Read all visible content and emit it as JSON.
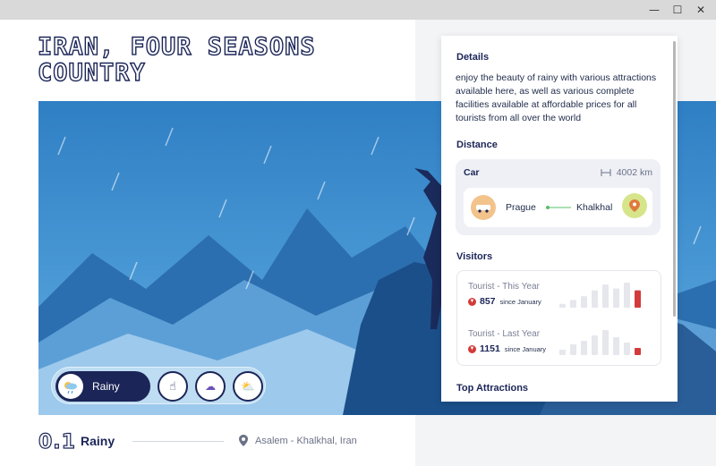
{
  "window": {
    "minimize_icon": "minimize-icon",
    "maximize_icon": "maximize-icon",
    "close_icon": "close-icon"
  },
  "hero": {
    "title": "Iran, Four Seasons Country"
  },
  "weather": {
    "active_label": "Rainy",
    "options": [
      "rainy",
      "storm",
      "snow",
      "sunny-cloudy"
    ]
  },
  "footer": {
    "index": "0.1",
    "condition": "Rainy",
    "location": "Asalem - Khalkhal, Iran"
  },
  "details": {
    "title": "Details",
    "text": "enjoy the beauty of rainy with various attractions available here, as well as various complete facilities available at affordable prices for all tourists from all over the world"
  },
  "distance": {
    "title": "Distance",
    "mode": "Car",
    "km": "4002 km",
    "from": "Prague",
    "to": "Khalkhal"
  },
  "visitors": {
    "title": "Visitors",
    "rows": [
      {
        "label": "Tourist - This Year",
        "value": "857",
        "since": "since January",
        "bars": [
          4,
          8,
          12,
          18,
          24,
          20,
          26,
          18
        ],
        "highlight_index": 7
      },
      {
        "label": "Tourist - Last Year",
        "value": "1151",
        "since": "since January",
        "bars": [
          6,
          12,
          16,
          22,
          28,
          20,
          14,
          8
        ],
        "highlight_index": 7
      }
    ]
  },
  "attractions": {
    "title": "Top Attractions"
  },
  "colors": {
    "navy": "#1b2557",
    "accent_red": "#d33b3b",
    "sky": "#3a8bd0"
  }
}
